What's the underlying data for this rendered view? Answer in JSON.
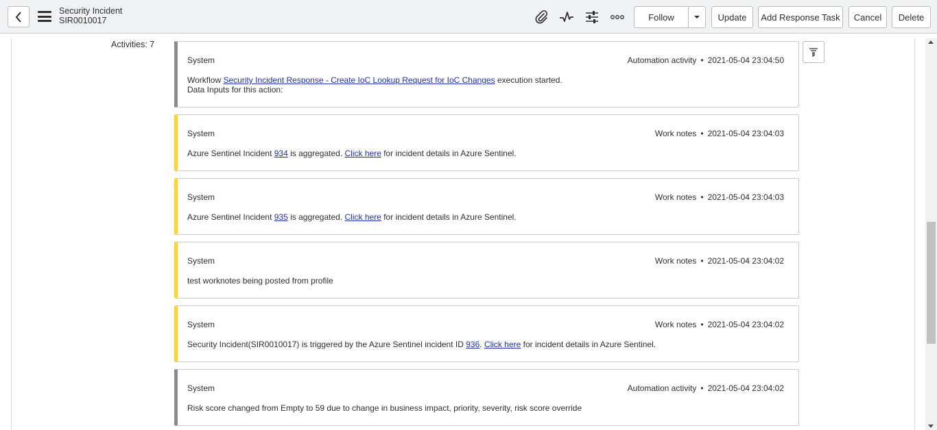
{
  "header": {
    "title": "Security Incident",
    "number": "SIR0010017",
    "buttons": {
      "follow": "Follow",
      "update": "Update",
      "add_response_task": "Add Response Task",
      "cancel": "Cancel",
      "delete": "Delete"
    },
    "icons": [
      "attachment-icon",
      "activity-icon",
      "settings-sliders-icon",
      "more-options-icon"
    ]
  },
  "activities": {
    "label": "Activities: 7",
    "items": [
      {
        "author": "System",
        "type": "Automation activity",
        "timestamp": "2021-05-04 23:04:50",
        "body_prefix": "Workflow ",
        "link": "Security Incident Response - Create IoC Lookup Request for IoC Changes",
        "body_suffix": " execution started.",
        "line2": "Data Inputs for this action:"
      },
      {
        "author": "System",
        "type": "Work notes",
        "timestamp": "2021-05-04 23:04:03",
        "pre": "Azure Sentinel Incident ",
        "incident_link": "934",
        "mid": " is aggregated. ",
        "click_link": "Click here",
        "post": " for incident details in Azure Sentinel."
      },
      {
        "author": "System",
        "type": "Work notes",
        "timestamp": "2021-05-04 23:04:03",
        "pre": "Azure Sentinel Incident ",
        "incident_link": "935",
        "mid": " is aggregated. ",
        "click_link": "Click here",
        "post": " for incident details in Azure Sentinel."
      },
      {
        "author": "System",
        "type": "Work notes",
        "timestamp": "2021-05-04 23:04:02",
        "text": "test worknotes being posted from profile"
      },
      {
        "author": "System",
        "type": "Work notes",
        "timestamp": "2021-05-04 23:04:02",
        "pre": "Security Incident(SIR0010017) is triggered by the Azure Sentinel incident ID ",
        "incident_link": "936",
        "mid": ". ",
        "click_link": "Click here",
        "post": " for incident details in Azure Sentinel."
      },
      {
        "author": "System",
        "type": "Automation activity",
        "timestamp": "2021-05-04 23:04:02",
        "text": "Risk score changed from Empty to 59 due to change in business impact, priority, severity, risk score override"
      }
    ]
  },
  "colors": {
    "automation_stripe": "#878b8e",
    "worknotes_stripe": "#f9d546",
    "link": "#1f2fb0",
    "header_bg": "#f1f2f3"
  }
}
